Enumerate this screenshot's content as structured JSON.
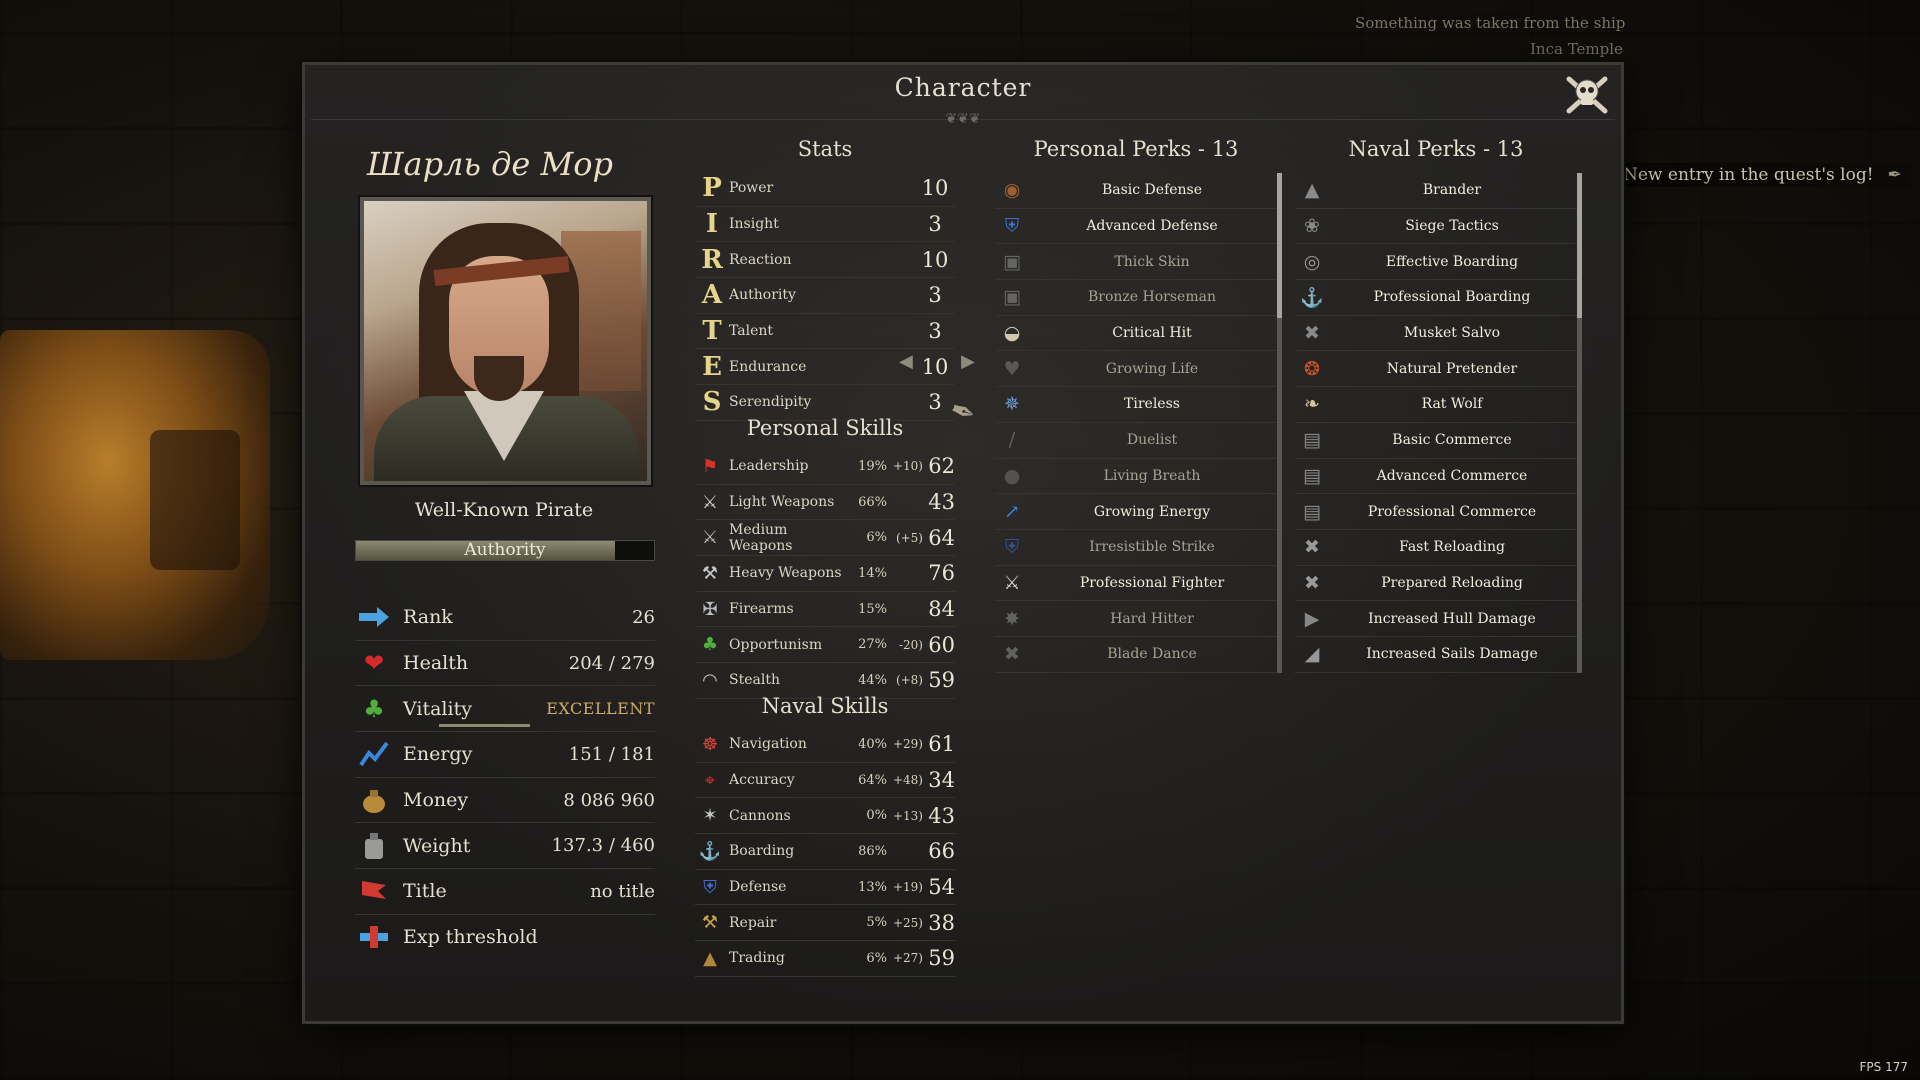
{
  "hud": {
    "top_note_1": "Something was taken from the ship",
    "top_note_2": "Inca Temple",
    "quest_note": "New entry in the quest's log!",
    "fps": "FPS 177"
  },
  "window": {
    "title": "Character",
    "close_icon": "skull-crossbones-icon"
  },
  "character": {
    "name": "Шарль де Мор",
    "reputation_title": "Well-Known Pirate",
    "authority_label": "Authority",
    "authority_progress": 0.87
  },
  "info": [
    {
      "label": "Rank",
      "value": "26",
      "icon": "rank-arrow-icon"
    },
    {
      "label": "Health",
      "value": "204 / 279",
      "icon": "heart-icon"
    },
    {
      "label": "Vitality",
      "value": "EXCELLENT",
      "icon": "clover-icon",
      "bar": 0.65
    },
    {
      "label": "Energy",
      "value": "151 / 181",
      "icon": "energy-icon"
    },
    {
      "label": "Money",
      "value": "8 086 960",
      "icon": "money-bag-icon"
    },
    {
      "label": "Weight",
      "value": "137.3 / 460",
      "icon": "weight-icon"
    },
    {
      "label": "Title",
      "value": "no title",
      "icon": "flag-icon"
    },
    {
      "label": "Exp threshold",
      "value": "",
      "icon": "exp-icon"
    }
  ],
  "stats": {
    "header": "Stats",
    "items": [
      {
        "letter": "P",
        "name": "Power",
        "value": "10"
      },
      {
        "letter": "I",
        "name": "Insight",
        "value": "3"
      },
      {
        "letter": "R",
        "name": "Reaction",
        "value": "10"
      },
      {
        "letter": "A",
        "name": "Authority",
        "value": "3"
      },
      {
        "letter": "T",
        "name": "Talent",
        "value": "3"
      },
      {
        "letter": "E",
        "name": "Endurance",
        "value": "10"
      },
      {
        "letter": "S",
        "name": "Serendipity",
        "value": "3"
      }
    ]
  },
  "personal_skills": {
    "header": "Personal Skills",
    "items": [
      {
        "name": "Leadership",
        "pct": "19%",
        "bonus": "+10)",
        "value": "62",
        "icon": "red-flag-icon"
      },
      {
        "name": "Light Weapons",
        "pct": "66%",
        "bonus": "",
        "value": "43",
        "icon": "crossed-swords-icon"
      },
      {
        "name": "Medium Weapons",
        "pct": "6%",
        "bonus": "(+5)",
        "value": "64",
        "icon": "crossed-sabres-icon"
      },
      {
        "name": "Heavy Weapons",
        "pct": "14%",
        "bonus": "",
        "value": "76",
        "icon": "axes-icon"
      },
      {
        "name": "Firearms",
        "pct": "15%",
        "bonus": "",
        "value": "84",
        "icon": "pistols-icon"
      },
      {
        "name": "Opportunism",
        "pct": "27%",
        "bonus": "-20)",
        "value": "60",
        "icon": "clover-icon"
      },
      {
        "name": "Stealth",
        "pct": "44%",
        "bonus": "(+8)",
        "value": "59",
        "icon": "mask-icon"
      }
    ]
  },
  "naval_skills": {
    "header": "Naval Skills",
    "items": [
      {
        "name": "Navigation",
        "pct": "40%",
        "bonus": "+29)",
        "value": "61",
        "icon": "helm-icon"
      },
      {
        "name": "Accuracy",
        "pct": "64%",
        "bonus": "+48)",
        "value": "34",
        "icon": "crosshair-icon"
      },
      {
        "name": "Cannons",
        "pct": "0%",
        "bonus": "+13)",
        "value": "43",
        "icon": "cannon-icon"
      },
      {
        "name": "Boarding",
        "pct": "86%",
        "bonus": "",
        "value": "66",
        "icon": "grapple-icon"
      },
      {
        "name": "Defense",
        "pct": "13%",
        "bonus": "+19)",
        "value": "54",
        "icon": "shield-icon"
      },
      {
        "name": "Repair",
        "pct": "5%",
        "bonus": "+25)",
        "value": "38",
        "icon": "hammer-icon"
      },
      {
        "name": "Trading",
        "pct": "6%",
        "bonus": "+27)",
        "value": "59",
        "icon": "sack-icon"
      }
    ]
  },
  "personal_perks": {
    "header": "Personal Perks  -  13",
    "items": [
      {
        "name": "Basic Defense",
        "active": true,
        "icon": "buckler-icon"
      },
      {
        "name": "Advanced Defense",
        "active": true,
        "icon": "shield-icon"
      },
      {
        "name": "Thick Skin",
        "active": false,
        "icon": "armor-icon"
      },
      {
        "name": "Bronze Horseman",
        "active": false,
        "icon": "armor-icon"
      },
      {
        "name": "Critical Hit",
        "active": true,
        "icon": "helmet-icon"
      },
      {
        "name": "Growing Life",
        "active": false,
        "icon": "heart-plus-icon"
      },
      {
        "name": "Tireless",
        "active": true,
        "icon": "tireless-icon"
      },
      {
        "name": "Duelist",
        "active": false,
        "icon": "rapier-icon"
      },
      {
        "name": "Living Breath",
        "active": false,
        "icon": "orb-icon"
      },
      {
        "name": "Growing Energy",
        "active": true,
        "icon": "energy-plus-icon"
      },
      {
        "name": "Irresistible Strike",
        "active": false,
        "icon": "shield-icon"
      },
      {
        "name": "Professional Fighter",
        "active": true,
        "icon": "crossed-swords-icon"
      },
      {
        "name": "Hard Hitter",
        "active": false,
        "icon": "fist-icon"
      },
      {
        "name": "Blade Dance",
        "active": false,
        "icon": "blade-icon"
      }
    ]
  },
  "naval_perks": {
    "header": "Naval Perks  -  13",
    "items": [
      {
        "name": "Brander",
        "active": true,
        "icon": "fireship-icon"
      },
      {
        "name": "Siege Tactics",
        "active": true,
        "icon": "siege-icon"
      },
      {
        "name": "Effective Boarding",
        "active": true,
        "icon": "boarding-icon"
      },
      {
        "name": "Professional Boarding",
        "active": true,
        "icon": "grapple-icon"
      },
      {
        "name": "Musket Salvo",
        "active": true,
        "icon": "muskets-icon"
      },
      {
        "name": "Natural Pretender",
        "active": true,
        "icon": "pretender-icon"
      },
      {
        "name": "Rat Wolf",
        "active": true,
        "icon": "rat-icon"
      },
      {
        "name": "Basic Commerce",
        "active": true,
        "icon": "commerce-icon"
      },
      {
        "name": "Advanced Commerce",
        "active": true,
        "icon": "commerce-icon"
      },
      {
        "name": "Professional Commerce",
        "active": true,
        "icon": "commerce-icon"
      },
      {
        "name": "Fast Reloading",
        "active": true,
        "icon": "reload-icon"
      },
      {
        "name": "Prepared Reloading",
        "active": true,
        "icon": "reload-icon"
      },
      {
        "name": "Increased Hull Damage",
        "active": true,
        "icon": "hull-icon"
      },
      {
        "name": "Increased Sails Damage",
        "active": true,
        "icon": "sail-icon"
      }
    ]
  }
}
